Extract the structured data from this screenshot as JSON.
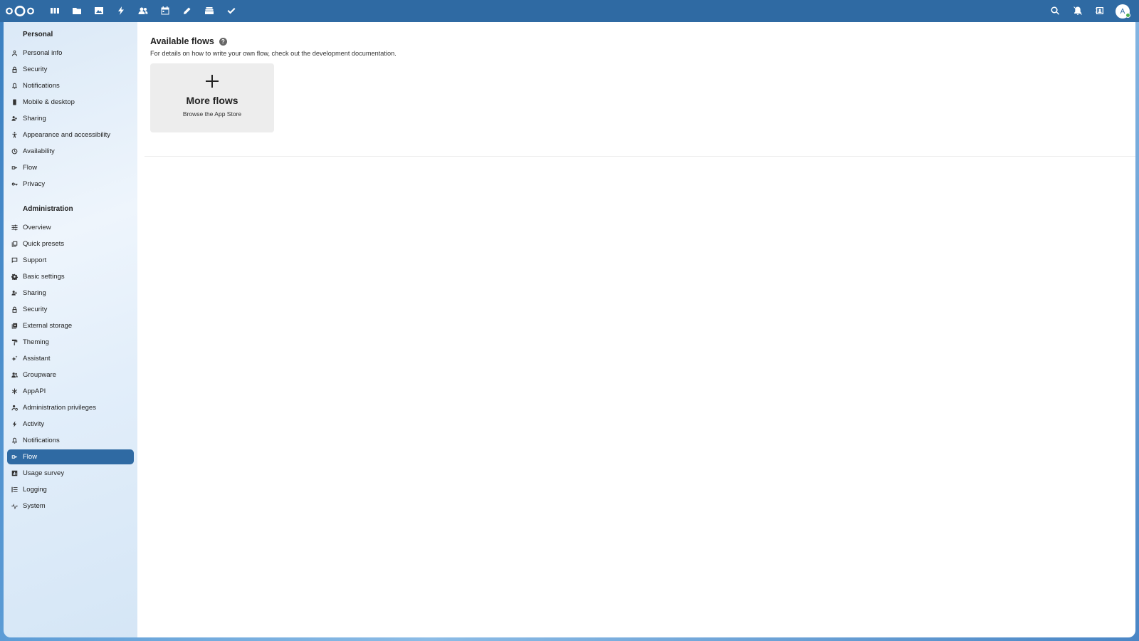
{
  "header": {
    "app_icons": [
      "dashboard-icon",
      "files-icon",
      "photos-icon",
      "activity-icon",
      "contacts-icon",
      "calendar-icon",
      "notes-icon",
      "deck-icon",
      "tasks-icon"
    ],
    "right_icons": [
      "search-icon",
      "notifications-icon",
      "contacts-menu-icon"
    ],
    "avatar_initial": "A",
    "brand_color": "#2f6aa3"
  },
  "sidebar": {
    "personal_title": "Personal",
    "personal_items": [
      {
        "label": "Personal info",
        "icon": "person-icon"
      },
      {
        "label": "Security",
        "icon": "lock-icon"
      },
      {
        "label": "Notifications",
        "icon": "bell-icon"
      },
      {
        "label": "Mobile & desktop",
        "icon": "phone-icon"
      },
      {
        "label": "Sharing",
        "icon": "share-icon"
      },
      {
        "label": "Appearance and accessibility",
        "icon": "accessibility-icon"
      },
      {
        "label": "Availability",
        "icon": "clock-icon"
      },
      {
        "label": "Flow",
        "icon": "flow-icon"
      },
      {
        "label": "Privacy",
        "icon": "key-icon"
      }
    ],
    "admin_title": "Administration",
    "admin_items": [
      {
        "label": "Overview",
        "icon": "sliders-icon"
      },
      {
        "label": "Quick presets",
        "icon": "presets-icon"
      },
      {
        "label": "Support",
        "icon": "chat-icon"
      },
      {
        "label": "Basic settings",
        "icon": "gear-icon"
      },
      {
        "label": "Sharing",
        "icon": "share-icon"
      },
      {
        "label": "Security",
        "icon": "lock-icon"
      },
      {
        "label": "External storage",
        "icon": "storage-icon"
      },
      {
        "label": "Theming",
        "icon": "paint-roller-icon"
      },
      {
        "label": "Assistant",
        "icon": "sparkle-icon"
      },
      {
        "label": "Groupware",
        "icon": "group-icon"
      },
      {
        "label": "AppAPI",
        "icon": "api-icon"
      },
      {
        "label": "Administration privileges",
        "icon": "admin-icon"
      },
      {
        "label": "Activity",
        "icon": "lightning-icon"
      },
      {
        "label": "Notifications",
        "icon": "bell-icon"
      },
      {
        "label": "Flow",
        "icon": "flow-icon",
        "active": true
      },
      {
        "label": "Usage survey",
        "icon": "chart-icon"
      },
      {
        "label": "Logging",
        "icon": "list-icon"
      },
      {
        "label": "System",
        "icon": "pulse-icon"
      }
    ]
  },
  "main": {
    "title": "Available flows",
    "description": "For details on how to write your own flow, check out the development documentation.",
    "card_title": "More flows",
    "card_subtitle": "Browse the App Store"
  }
}
